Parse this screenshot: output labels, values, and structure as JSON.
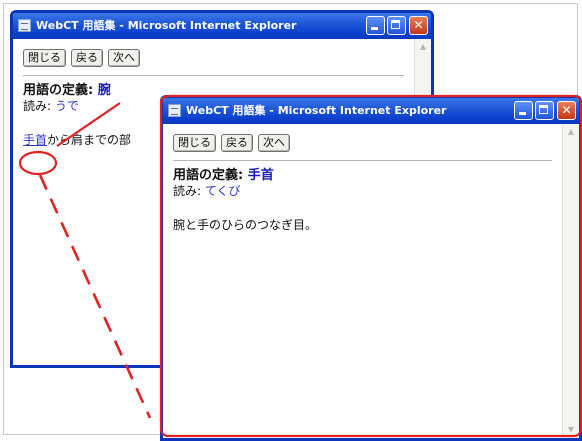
{
  "window_back": {
    "title": "WebCT 用語集 - Microsoft Internet Explorer",
    "buttons": [
      "閉じる",
      "戻る",
      "次へ"
    ],
    "definition_label": "用語の定義:",
    "term": "腕",
    "reading_label": "読み:",
    "reading": "うで",
    "definition_link": "手首",
    "definition_rest": "から肩までの部"
  },
  "window_front": {
    "title": "WebCT 用語集 - Microsoft Internet Explorer",
    "buttons": [
      "閉じる",
      "戻る",
      "次へ"
    ],
    "definition_label": "用語の定義:",
    "term": "手首",
    "reading_label": "読み:",
    "reading": "てくび",
    "definition": "腕と手のひらのつなぎ目。"
  },
  "colors": {
    "titlebar": "#0a35b8",
    "link": "#2e38c9",
    "annotation": "#e02222"
  },
  "icons": [
    "ie-page-icon",
    "minimize-icon",
    "maximize-icon",
    "close-icon",
    "scroll-up-arrow-icon",
    "scroll-down-arrow-icon"
  ]
}
